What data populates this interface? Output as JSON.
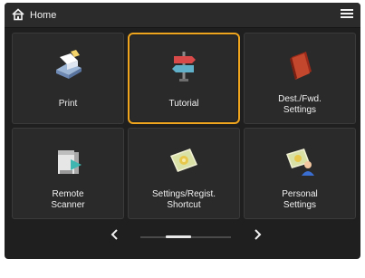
{
  "header": {
    "home_label": "Home"
  },
  "tiles": [
    {
      "label_lines": [
        "Print"
      ],
      "icon": "print-icon",
      "selected": false
    },
    {
      "label_lines": [
        "Tutorial"
      ],
      "icon": "signpost-icon",
      "selected": true
    },
    {
      "label_lines": [
        "Dest./Fwd.",
        "Settings"
      ],
      "icon": "address-book-icon",
      "selected": false
    },
    {
      "label_lines": [
        "Remote",
        "Scanner"
      ],
      "icon": "scanner-icon",
      "selected": false
    },
    {
      "label_lines": [
        "Settings/Regist.",
        "Shortcut"
      ],
      "icon": "settings-shortcut-icon",
      "selected": false
    },
    {
      "label_lines": [
        "Personal",
        "Settings"
      ],
      "icon": "personal-settings-icon",
      "selected": false
    }
  ],
  "pager": {
    "page": 1,
    "page_count": 3
  },
  "colors": {
    "selection": "#f0a51e",
    "screen_bg": "#1f1f1f",
    "tile_bg": "#2a2a2a"
  }
}
